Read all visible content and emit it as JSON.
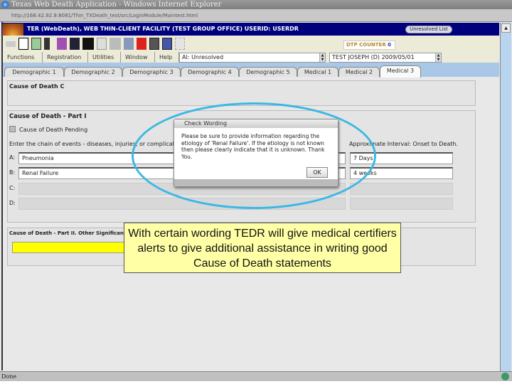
{
  "window": {
    "title": "Texas Web Death Application - Windows Internet Explorer",
    "address": "http://168.42.92.9:8081/Thin_TXDeath_test/src/LoginModule/Maintest.html",
    "status": "Done"
  },
  "header": {
    "logo": "GENESIS",
    "title": "TER (WebDeath), WEB THIN-CLIENT FACILITY (TEST GROUP OFFICE) USERID: USERDR",
    "unresolved_button": "Unresolved List",
    "dtp_label": "DTP COUNTER",
    "dtp_value": "0"
  },
  "menu": [
    "Functions",
    "Registration",
    "Utilities",
    "Window",
    "Help"
  ],
  "combos": {
    "status": "AI: Unresolved",
    "record": "TEST JOSEPH (D) 2009/05/01"
  },
  "tabs": [
    {
      "label": "Demographic 1"
    },
    {
      "label": "Demographic 2"
    },
    {
      "label": "Demographic 3"
    },
    {
      "label": "Demographic 4"
    },
    {
      "label": "Demographic 5"
    },
    {
      "label": "Medical 1"
    },
    {
      "label": "Medical 2"
    },
    {
      "label": "Medical 3",
      "active": true
    }
  ],
  "form": {
    "section_c": "Cause of Death C",
    "part1_title": "Cause of Death - Part I",
    "pending_label": "Cause of Death Pending",
    "chain_label": "Enter the chain of events - diseases, injuries, or complications",
    "interval_label": "Approximate Interval: Onset to Death.",
    "rows": [
      {
        "letter": "A:",
        "cause": "Pneumonia",
        "interval": "7 Days"
      },
      {
        "letter": "B:",
        "cause": "Renal Failure",
        "interval": "4 weeks"
      },
      {
        "letter": "C:",
        "cause": "",
        "interval": ""
      },
      {
        "letter": "D:",
        "cause": "",
        "interval": ""
      }
    ],
    "part2_title": "Cause of Death - Part II. Other Significant Conditions"
  },
  "dialog": {
    "title": "Check Wording",
    "message": "Please be sure to provide information regarding the etiology of 'Renal Failure'. If the etiology is not known then please clearly indicate that it is unknown. Thank You.",
    "ok": "OK"
  },
  "callout": {
    "text": "With certain wording TEDR will give medical certifiers alerts to give additional assistance in writing good Cause of Death statements"
  },
  "colors": {
    "header": "#00007f",
    "highlight_ellipse": "#3ab8e4",
    "callout_bg": "#ffffa6",
    "required_field": "#ffff00"
  }
}
